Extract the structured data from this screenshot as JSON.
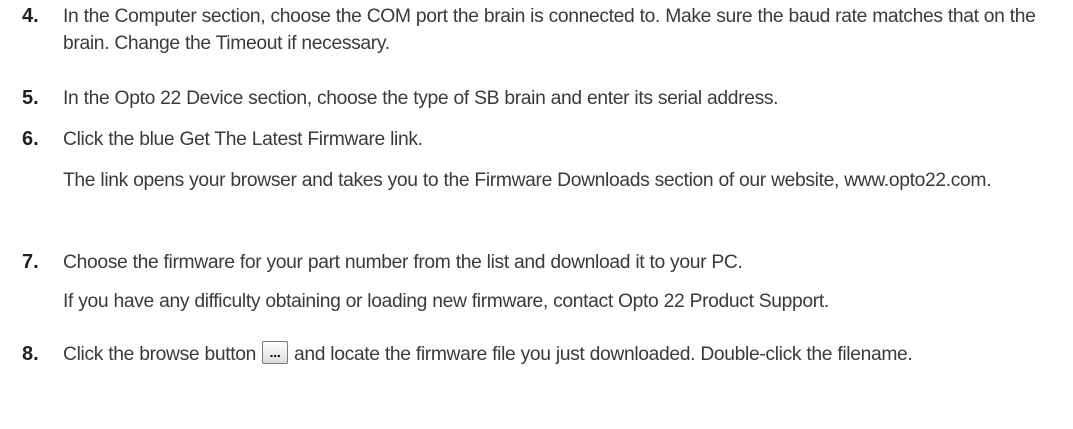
{
  "steps": [
    {
      "number": "4.",
      "text": "In the Computer section, choose the COM port the brain is connected to. Make sure the baud rate matches that on the brain. Change the Timeout if necessary."
    },
    {
      "number": "5.",
      "text": "In the Opto 22 Device section, choose the type of SB brain and enter its serial address."
    },
    {
      "number": "6.",
      "text": "Click the blue Get The Latest Firmware link.",
      "note": "The link opens your browser and takes you to the Firmware Downloads section of our website, www.opto22.com."
    },
    {
      "number": "7.",
      "text": "Choose the firmware for your part number from the list and download it to your PC.",
      "note": "If you have any difficulty obtaining or loading new firmware, contact Opto 22 Product Support."
    },
    {
      "number": "8.",
      "text_before": "Click the browse button",
      "button_label": "...",
      "text_after": "and locate the firmware file you just downloaded. Double-click the filename."
    }
  ]
}
